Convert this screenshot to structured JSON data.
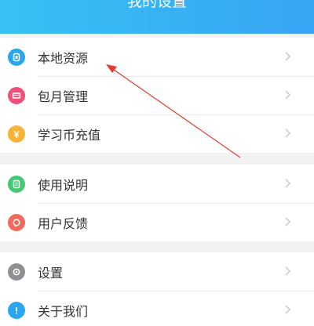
{
  "header": {
    "title": "我的设置"
  },
  "groups": [
    {
      "items": [
        {
          "label": "本地资源",
          "icon": "local-resources-icon",
          "color": "#2aa5ee"
        },
        {
          "label": "包月管理",
          "icon": "monthly-subscription-icon",
          "color": "#f0507a"
        },
        {
          "label": "学习币充值",
          "icon": "yen-coin-icon",
          "color": "#f6b336"
        }
      ]
    },
    {
      "items": [
        {
          "label": "使用说明",
          "icon": "instructions-icon",
          "color": "#45c876"
        },
        {
          "label": "用户反馈",
          "icon": "feedback-icon",
          "color": "#f06a5e"
        }
      ]
    },
    {
      "items": [
        {
          "label": "设置",
          "icon": "gear-icon",
          "color": "#8e8e93"
        },
        {
          "label": "关于我们",
          "icon": "info-icon",
          "color": "#2aa5ee"
        }
      ]
    }
  ],
  "annotation": {
    "arrow_color": "#e53935"
  }
}
